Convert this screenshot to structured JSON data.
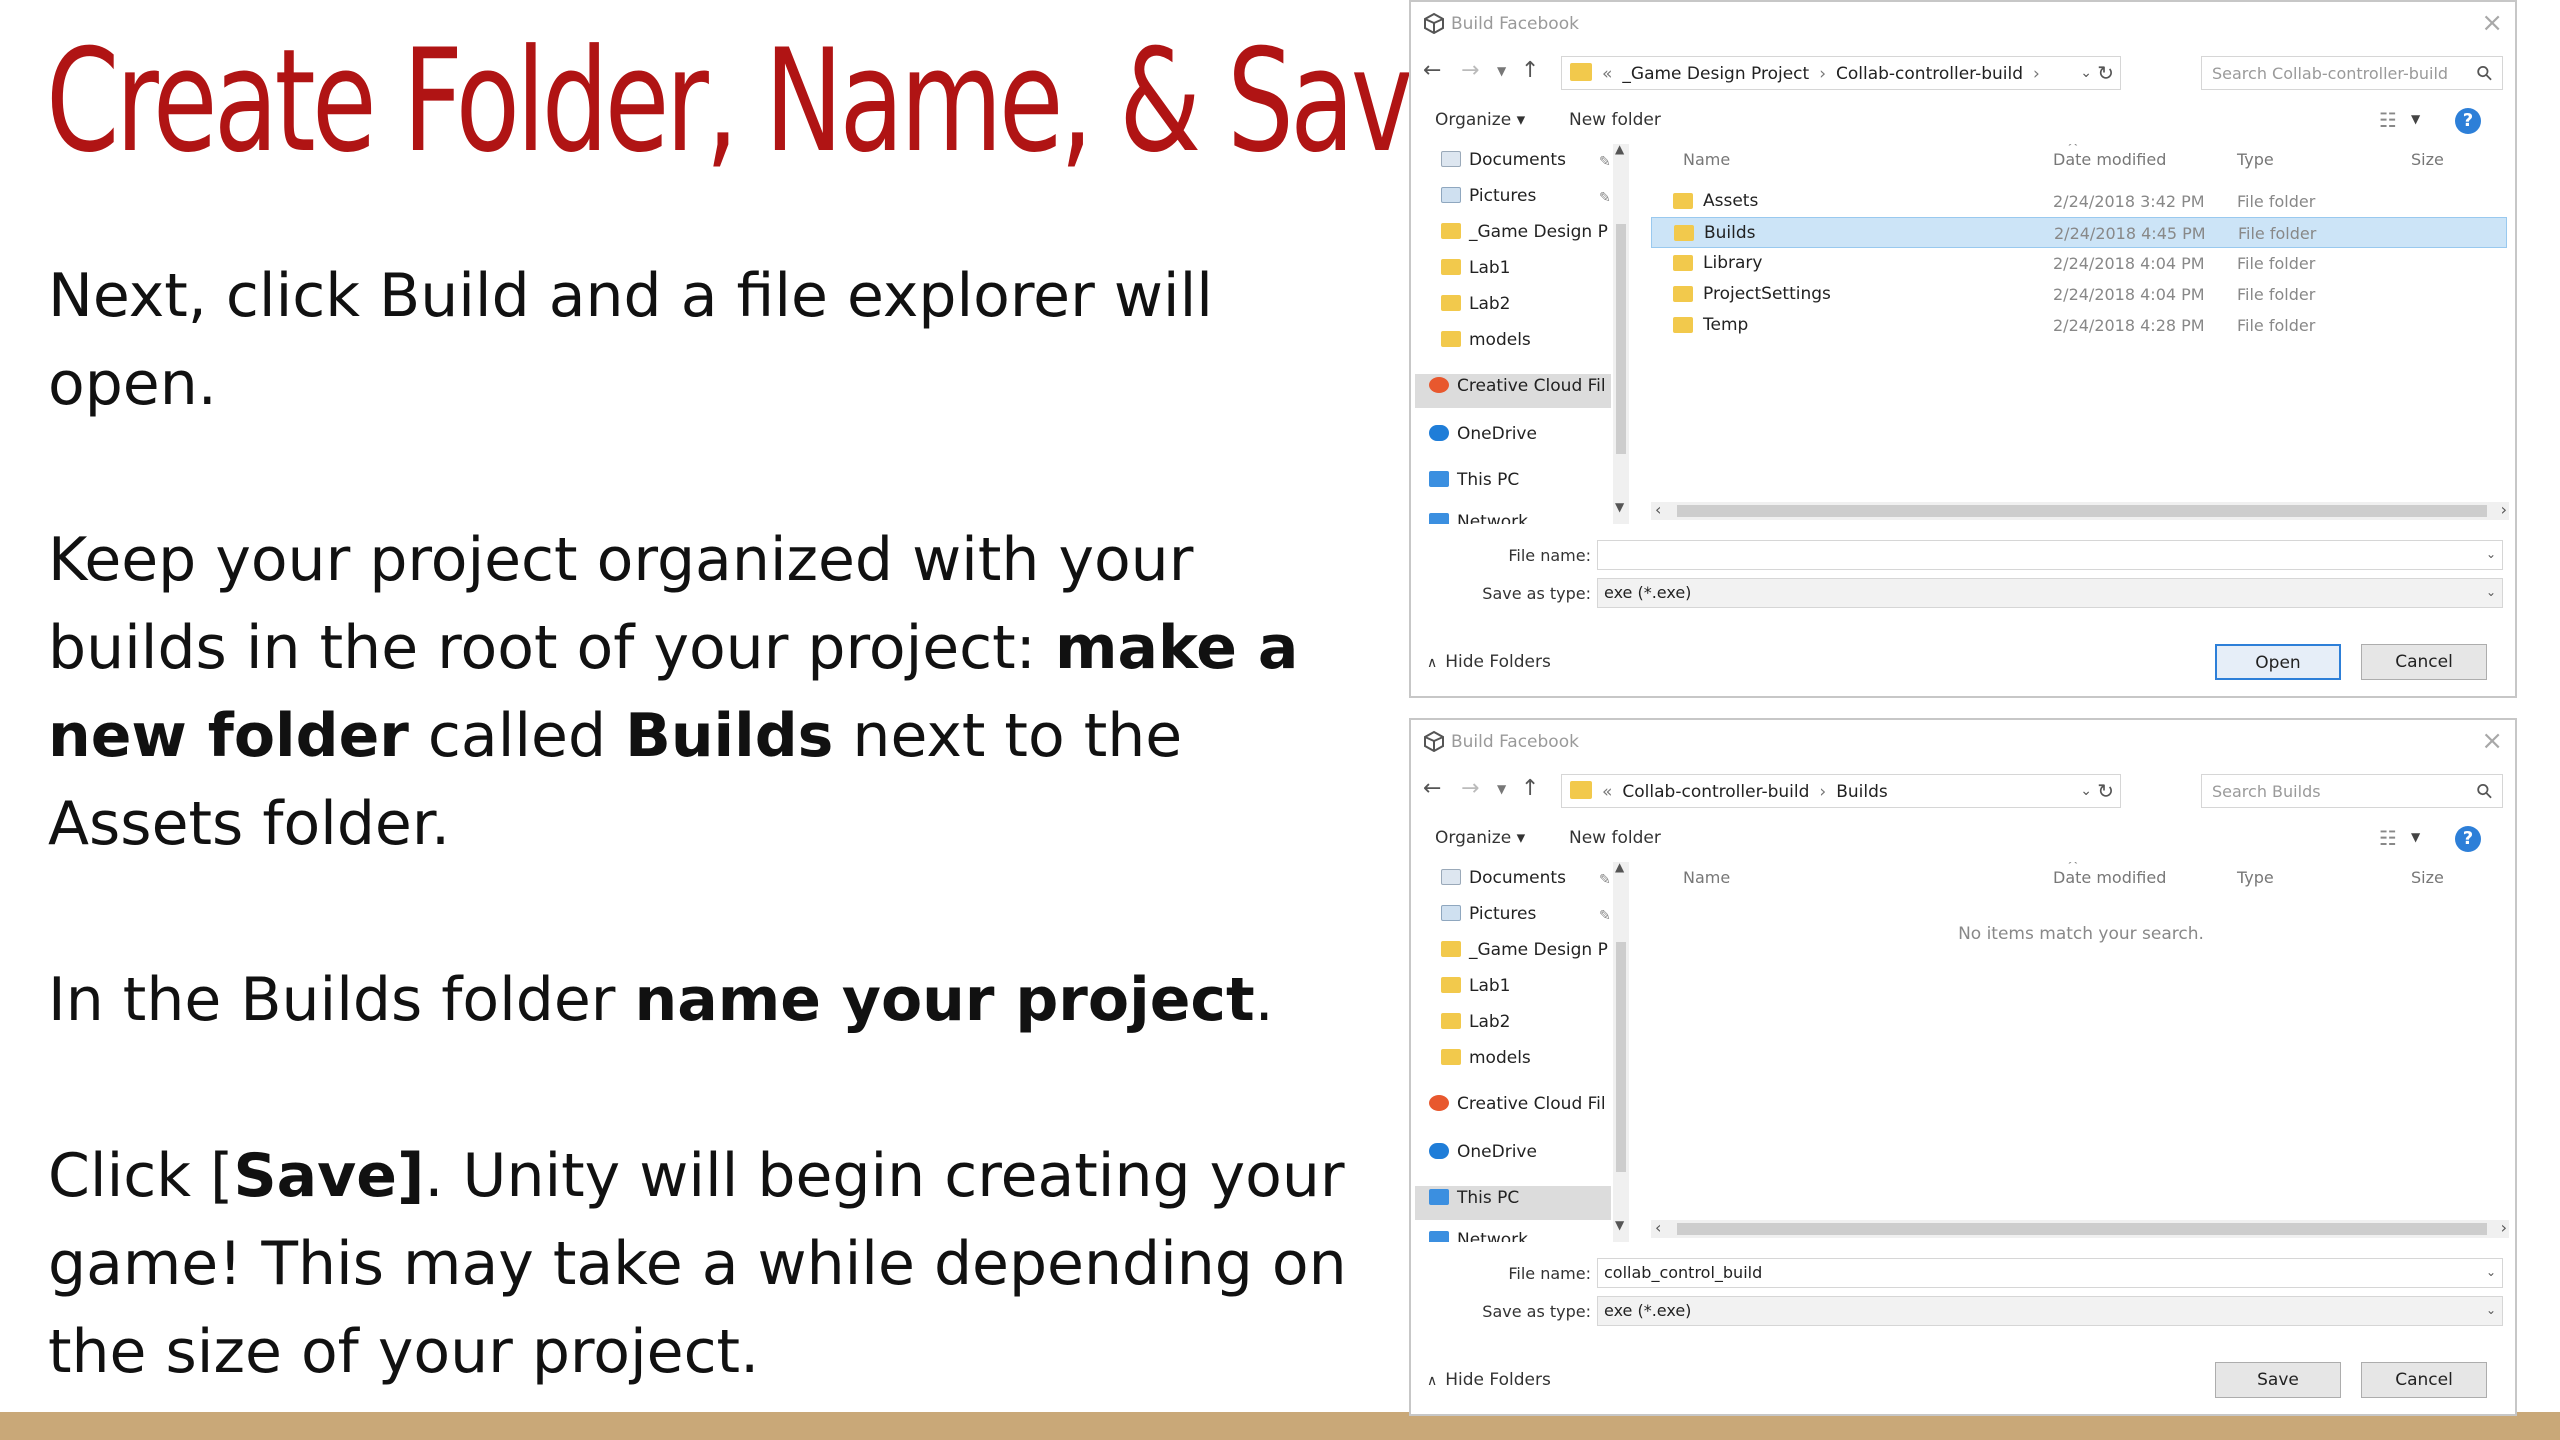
{
  "slide": {
    "title": "Create Folder, Name, & Save",
    "p1": "Next, click Build and a file explorer will open.",
    "p2": {
      "a": "Keep your project organized with your builds in the root of your project: ",
      "b": "make a new folder",
      "c": " called ",
      "d": "Builds",
      "e": " next to the Assets folder."
    },
    "p3": {
      "a": "In the Builds folder ",
      "b": "name your project",
      "c": "."
    },
    "p4": {
      "a": "Click [",
      "b": "Save]",
      "c": ". Unity will begin creating your game! This may take a while depending on the size of your project."
    },
    "accent_color": "#b01414",
    "bar_color": "#c9a878"
  },
  "dialog1": {
    "title": "Build Facebook",
    "breadcrumb": [
      "_Game Design Project",
      "Collab-controller-build"
    ],
    "search_placeholder": "Search Collab-controller-build",
    "organize": "Organize",
    "new_folder": "New folder",
    "nav_items": [
      "Documents",
      "Pictures",
      "_Game Design P",
      "Lab1",
      "Lab2",
      "models",
      "Creative Cloud Fil",
      "OneDrive",
      "This PC",
      "Network"
    ],
    "columns": [
      "Name",
      "Date modified",
      "Type",
      "Size"
    ],
    "rows": [
      {
        "name": "Assets",
        "date": "2/24/2018 3:42 PM",
        "type": "File folder"
      },
      {
        "name": "Builds",
        "date": "2/24/2018 4:45 PM",
        "type": "File folder"
      },
      {
        "name": "Library",
        "date": "2/24/2018 4:04 PM",
        "type": "File folder"
      },
      {
        "name": "ProjectSettings",
        "date": "2/24/2018 4:04 PM",
        "type": "File folder"
      },
      {
        "name": "Temp",
        "date": "2/24/2018 4:28 PM",
        "type": "File folder"
      }
    ],
    "selected_row": "Builds",
    "file_name_label": "File name:",
    "file_name_value": "",
    "save_type_label": "Save as type:",
    "save_type_value": "exe (*.exe)",
    "hide_folders": "Hide Folders",
    "primary_button": "Open",
    "cancel_button": "Cancel"
  },
  "dialog2": {
    "title": "Build Facebook",
    "breadcrumb": [
      "Collab-controller-build",
      "Builds"
    ],
    "search_placeholder": "Search Builds",
    "organize": "Organize",
    "new_folder": "New folder",
    "nav_items": [
      "Documents",
      "Pictures",
      "_Game Design P",
      "Lab1",
      "Lab2",
      "models",
      "Creative Cloud Fil",
      "OneDrive",
      "This PC",
      "Network"
    ],
    "columns": [
      "Name",
      "Date modified",
      "Type",
      "Size"
    ],
    "empty_message": "No items match your search.",
    "file_name_label": "File name:",
    "file_name_value": "collab_control_build",
    "save_type_label": "Save as type:",
    "save_type_value": "exe (*.exe)",
    "hide_folders": "Hide Folders",
    "primary_button": "Save",
    "cancel_button": "Cancel"
  }
}
